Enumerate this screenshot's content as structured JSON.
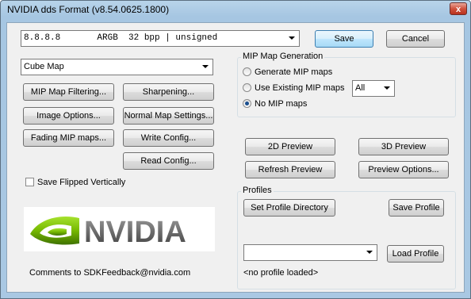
{
  "window": {
    "title": "NVIDIA dds Format (v8.54.0625.1800)",
    "close_glyph": "x"
  },
  "format_select": {
    "value": "8.8.8.8       ARGB  32 bpp | unsigned"
  },
  "buttons": {
    "save": "Save",
    "cancel": "Cancel",
    "mip_map_filtering": "MIP Map Filtering...",
    "sharpening": "Sharpening...",
    "image_options": "Image Options...",
    "normal_map_settings": "Normal Map Settings...",
    "fading_mip_maps": "Fading MIP maps...",
    "write_config": "Write Config...",
    "read_config": "Read Config...",
    "preview_2d": "2D Preview",
    "preview_3d": "3D Preview",
    "refresh_preview": "Refresh Preview",
    "preview_options": "Preview Options...",
    "set_profile_directory": "Set Profile Directory",
    "save_profile": "Save Profile",
    "load_profile": "Load Profile"
  },
  "texture_type_select": {
    "value": "Cube Map"
  },
  "mip_generation": {
    "label": "MIP Map Generation",
    "options": [
      {
        "label": "Generate MIP maps",
        "selected": false
      },
      {
        "label": "Use Existing MIP maps",
        "selected": false
      },
      {
        "label": "No MIP maps",
        "selected": true
      }
    ],
    "levels_select": "All"
  },
  "save_flipped": {
    "label": "Save Flipped Vertically",
    "checked": false
  },
  "profiles": {
    "label": "Profiles",
    "profile_select": "",
    "status": "<no profile loaded>"
  },
  "logo": {
    "text": "NVIDIA"
  },
  "footer": {
    "comments": "Comments to SDKFeedback@nvidia.com"
  },
  "colors": {
    "nvidia_green": "#76b900",
    "logo_gray": "#6b6b6b"
  }
}
